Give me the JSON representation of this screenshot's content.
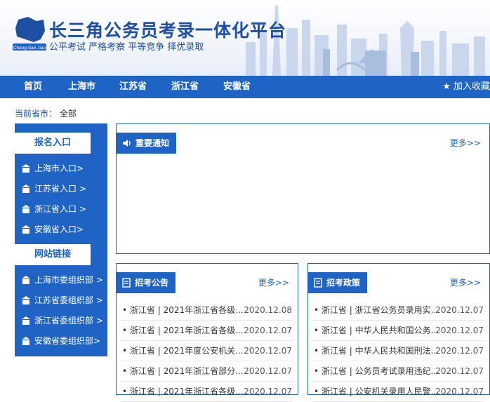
{
  "header": {
    "title": "长三角公务员考录一体化平台",
    "slogan": "公平考试 严格考察 平等竞争 择优录取",
    "logo_text": "Chang San Jiao"
  },
  "nav": {
    "items": [
      "首页",
      "上海市",
      "江苏省",
      "浙江省",
      "安徽省"
    ],
    "favorite": "★ 加入收藏"
  },
  "breadcrumb": {
    "label": "当前省市：",
    "value": "全部"
  },
  "sidebar": {
    "section1": "报名入口",
    "entries": [
      "上海市入口>",
      "江苏省入口 >",
      "浙江省入口 >",
      "安徽省入口>"
    ],
    "section2": "网站链接",
    "links": [
      "上海市委组织部 >",
      "江苏省委组织部 >",
      "浙江省委组织部 >",
      "安徽省委组织部>"
    ]
  },
  "notice": {
    "title": "重要通知",
    "more": "更多>>"
  },
  "recruit": {
    "title": "招考公告",
    "more": "更多>>",
    "items": [
      {
        "text": "• 浙江省 | 2021年浙江省各级...",
        "date": "2020.12.08"
      },
      {
        "text": "• 浙江省 | 2021年浙江省各级...",
        "date": "2020.12.07"
      },
      {
        "text": "• 浙江省 | 2021年度公安机关...",
        "date": "2020.12.07"
      },
      {
        "text": "• 浙江省 | 2021年浙江省部分...",
        "date": "2020.12.07"
      },
      {
        "text": "• 浙江省 | 2021年浙江省各级...",
        "date": "2020.12.07"
      }
    ]
  },
  "policy": {
    "title": "招考政策",
    "more": "更多>>",
    "items": [
      {
        "text": "• 浙江省 | 浙江省公务员录用实...",
        "date": "2020.12.07"
      },
      {
        "text": "• 浙江省 | 中华人民共和国公务...",
        "date": "2020.12.07"
      },
      {
        "text": "• 浙江省 | 中华人民共和国刑法...",
        "date": "2020.12.07"
      },
      {
        "text": "• 浙江省 | 公务员考试录用违纪...",
        "date": "2020.12.07"
      },
      {
        "text": "• 浙江省 | 公安机关录用人民警...",
        "date": "2020.12.07"
      }
    ]
  },
  "colors": {
    "primary": "#1f63c4",
    "title": "#1f4fa3"
  }
}
